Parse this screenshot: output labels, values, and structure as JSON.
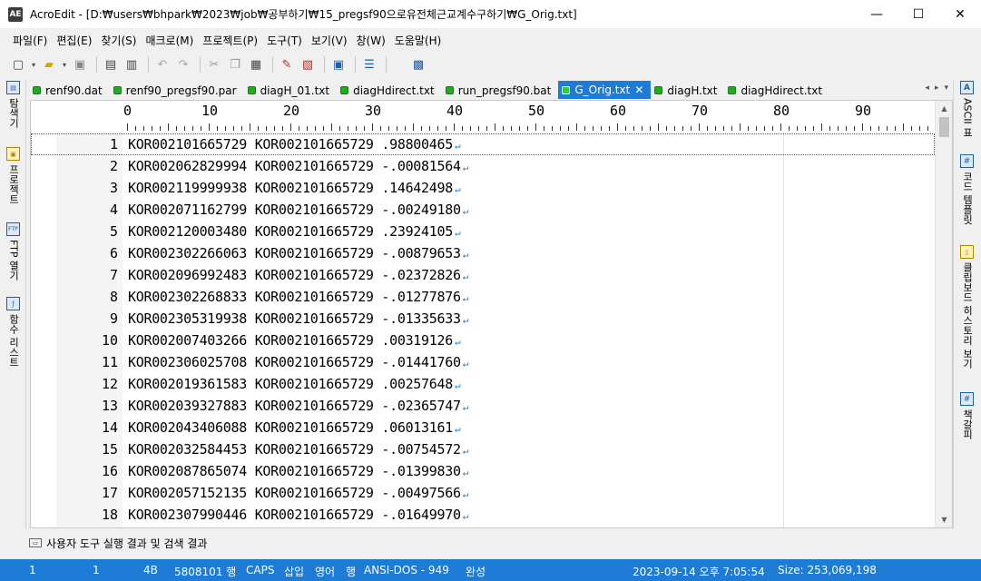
{
  "window": {
    "app_icon": "AE",
    "title": "AcroEdit - [D:₩users₩bhpark₩2023₩job₩공부하기₩15_pregsf90으로유전체근교계수구하기₩G_Orig.txt]",
    "minimize": "—",
    "maximize": "☐",
    "close": "✕"
  },
  "menu": [
    "파일(F)",
    "편집(E)",
    "찾기(S)",
    "매크로(M)",
    "프로젝트(P)",
    "도구(T)",
    "보기(V)",
    "창(W)",
    "도움말(H)"
  ],
  "tabs": [
    {
      "label": "renf90.dat",
      "active": false
    },
    {
      "label": "renf90_pregsf90.par",
      "active": false
    },
    {
      "label": "diagH_01.txt",
      "active": false
    },
    {
      "label": "diagHdirect.txt",
      "active": false
    },
    {
      "label": "run_pregsf90.bat",
      "active": false
    },
    {
      "label": "G_Orig.txt",
      "active": true
    },
    {
      "label": "diagH.txt",
      "active": false
    },
    {
      "label": "diagHdirect.txt",
      "active": false
    }
  ],
  "tab_close": "✕",
  "tab_nav": {
    "prev": "◂",
    "next": "▸",
    "list": "▾"
  },
  "left_sidebar": [
    {
      "icon": "explorer-icon",
      "glyph": "▤",
      "label": "탐색기"
    },
    {
      "icon": "project-icon",
      "glyph": "▣",
      "label": "프로젝트"
    },
    {
      "icon": "ftp-icon",
      "glyph": "FTP",
      "label": "FTP 열기"
    },
    {
      "icon": "function-list-icon",
      "glyph": "ƒ",
      "label": "함수 리스트"
    }
  ],
  "right_sidebar": [
    {
      "icon": "ascii-table-icon",
      "glyph": "A",
      "label": "ASCII 표"
    },
    {
      "icon": "code-template-icon",
      "glyph": "#",
      "label": "코드 템플릿"
    },
    {
      "icon": "clipboard-history-icon",
      "glyph": "▯",
      "label": "클립보드 히스토리 보기"
    },
    {
      "icon": "bookmark-icon",
      "glyph": "#",
      "label": "책갈피"
    }
  ],
  "ruler": [
    "0",
    "10",
    "20",
    "30",
    "40",
    "50",
    "60",
    "70",
    "80",
    "90"
  ],
  "lines": [
    {
      "n": "1",
      "text": "KOR002101665729 KOR002101665729 .98800465"
    },
    {
      "n": "2",
      "text": "KOR002062829994 KOR002101665729 -.00081564"
    },
    {
      "n": "3",
      "text": "KOR002119999938 KOR002101665729 .14642498"
    },
    {
      "n": "4",
      "text": "KOR002071162799 KOR002101665729 -.00249180"
    },
    {
      "n": "5",
      "text": "KOR002120003480 KOR002101665729 .23924105"
    },
    {
      "n": "6",
      "text": "KOR002302266063 KOR002101665729 -.00879653"
    },
    {
      "n": "7",
      "text": "KOR002096992483 KOR002101665729 -.02372826"
    },
    {
      "n": "8",
      "text": "KOR002302268833 KOR002101665729 -.01277876"
    },
    {
      "n": "9",
      "text": "KOR002305319938 KOR002101665729 -.01335633"
    },
    {
      "n": "10",
      "text": "KOR002007403266 KOR002101665729 .00319126"
    },
    {
      "n": "11",
      "text": "KOR002306025708 KOR002101665729 -.01441760"
    },
    {
      "n": "12",
      "text": "KOR002019361583 KOR002101665729 .00257648"
    },
    {
      "n": "13",
      "text": "KOR002039327883 KOR002101665729 -.02365747"
    },
    {
      "n": "14",
      "text": "KOR002043406088 KOR002101665729 .06013161"
    },
    {
      "n": "15",
      "text": "KOR002032584453 KOR002101665729 -.00754572"
    },
    {
      "n": "16",
      "text": "KOR002087865074 KOR002101665729 -.01399830"
    },
    {
      "n": "17",
      "text": "KOR002057152135 KOR002101665729 -.00497566"
    },
    {
      "n": "18",
      "text": "KOR002307990446 KOR002101665729 -.01649970"
    }
  ],
  "eol_mark": "↵",
  "output_panel": {
    "label": "사용자 도구 실행 결과 및 검색 결과"
  },
  "status": {
    "line": "1",
    "col": "1",
    "byte": "4B",
    "total_lines": "5808101 행",
    "caps": "CAPS",
    "insert": "삽입",
    "lang": "영어",
    "mode": "행",
    "encoding": "ANSI-DOS - 949",
    "state": "완성",
    "datetime": "2023-09-14 오후 7:05:54",
    "size": "Size: 253,069,198"
  },
  "colors": {
    "accent": "#1e7bd6",
    "tab_dot": "#22aa22"
  }
}
